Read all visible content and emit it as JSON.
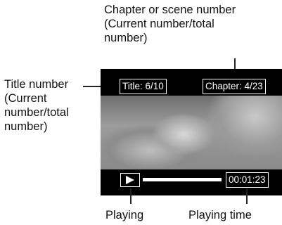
{
  "callouts": {
    "chapter_line1": "Chapter or scene number",
    "chapter_line2": "(Current number/total",
    "chapter_line3": "number)",
    "title_line1": "Title number",
    "title_line2": "(Current",
    "title_line3": "number/total",
    "title_line4": "number)",
    "playing": "Playing",
    "playing_time": "Playing time"
  },
  "screen": {
    "title_number": "Title:  6/10",
    "chapter_number": "Chapter:  4/23",
    "time": "00:01:23"
  }
}
